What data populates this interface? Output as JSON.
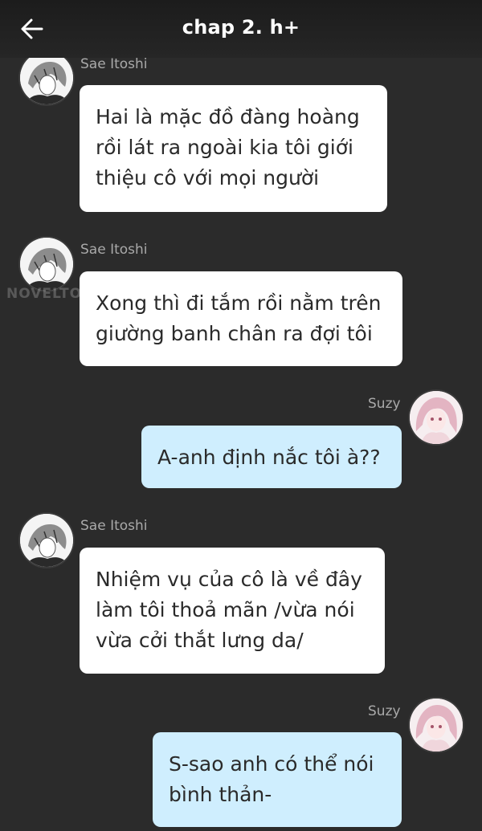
{
  "header": {
    "title": "chap 2. h+",
    "back_icon": "arrow-left-icon"
  },
  "watermark": "NOVELTOON",
  "messages": [
    {
      "sender": "Sae Itoshi",
      "side": "left",
      "lines": [
        "Hai là mặc đồ đàng hoàng",
        "rồi lát ra ngoài kia tôi giới",
        "thiệu cô với mọi người"
      ]
    },
    {
      "sender": "Sae Itoshi",
      "side": "left",
      "lines": [
        "Xong thì đi tắm rồi nằm trên",
        "giường banh chân ra đợi tôi"
      ]
    },
    {
      "sender": "Suzy",
      "side": "right",
      "lines": [
        "A-anh định nắc tôi à??"
      ]
    },
    {
      "sender": "Sae Itoshi",
      "side": "left",
      "lines": [
        "Nhiệm vụ của cô là về đây",
        "làm tôi thoả mãn /vừa nói",
        "vừa cởi thắt lưng da/"
      ]
    },
    {
      "sender": "Suzy",
      "side": "right",
      "lines": [
        "S-sao anh có thể nói",
        "bình thản-"
      ]
    }
  ],
  "colors": {
    "background": "#2b2b2b",
    "left_bubble": "#ffffff",
    "right_bubble": "#cfeefe",
    "name_text": "#a9a9a9"
  }
}
